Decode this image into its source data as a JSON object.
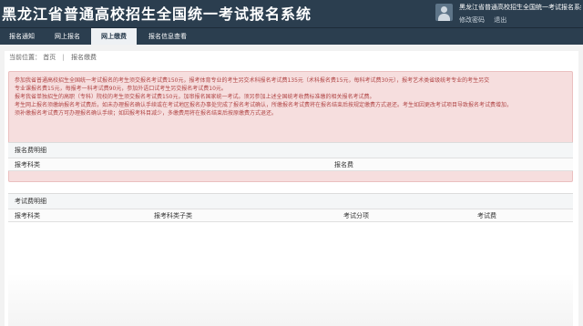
{
  "header": {
    "title": "黑龙江省普通高校招生全国统一考试报名系统",
    "user_name": "黑龙江省普通高校招生全国统一考试报名系统",
    "links": [
      "修改密码",
      "退出"
    ]
  },
  "nav": {
    "items": [
      "报名通知",
      "网上报名",
      "网上缴费",
      "报名信息查看"
    ],
    "active": "网上缴费"
  },
  "breadcrumb": {
    "label": "当前位置：",
    "items": [
      "首页",
      "报名缴费"
    ]
  },
  "notice": {
    "lines": [
      "参加我省普通高校招生全国统一考试报名的考生须交报名考试费150元，报考体育专业的考生另交术科报名考试费135元（术科报名费15元，每科考试费30元），报考艺术类省级统考专业的考生另交",
      "专业课报名费15元，每报考一科考试费90元，参加外语口试考生另交报名考试费10元。",
      "报考我省单独招生的高职（专科）院校的考生须交报名考试费150元，加审报名国家统一考试。须另参加上述全国统考收费标准缴的相关报名考试费。",
      "考生网上报名须缴纳报名考试费后，如未办理报名确认手续或在考试地区报名办事处完成了报名考试确认，所缴报名考试费将在报名结束后按规定缴费方式退还。考生如因更改考试项目导致报名考试费增加，",
      "须补缴报名考试费方可办理报名确认手续；如因报考科目减少，多缴费用将在报名结束后按原缴费方式退还。"
    ]
  },
  "fee_details": {
    "title": "报名费明细",
    "columns": [
      "报考科类",
      "报名费"
    ]
  },
  "exam_fee_details": {
    "title": "考试费明细",
    "columns": [
      "报考科类",
      "报考科类子类",
      "考试分项",
      "考试费"
    ]
  },
  "colors": {
    "header_bg": "#2b3e4f",
    "notice_bg": "#f6dede",
    "notice_text": "#b04646",
    "active_tab_bg": "#eef1f4"
  },
  "icons": {
    "avatar": "user-avatar-icon"
  }
}
